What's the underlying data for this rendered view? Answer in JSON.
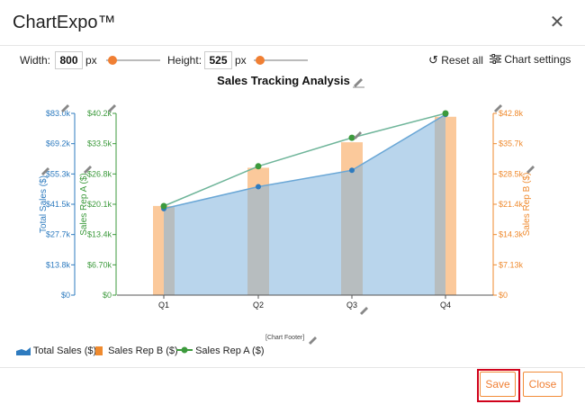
{
  "app": {
    "title": "ChartExpo™"
  },
  "toolbar": {
    "width_label": "Width:",
    "width_value": "800",
    "width_unit": "px",
    "height_label": "Height:",
    "height_value": "525",
    "height_unit": "px",
    "reset_label": "Reset all",
    "settings_label": "Chart settings",
    "width_slider": 0.12,
    "height_slider": 0.12
  },
  "chart_data": {
    "type": "bar",
    "title": "Sales Tracking Analysis",
    "categories": [
      "Q1",
      "Q2",
      "Q3",
      "Q4"
    ],
    "series": [
      {
        "name": "Total Sales ($)",
        "type": "area",
        "axis": "left-outer",
        "color": "#7fb3dc",
        "values": [
          39500,
          49500,
          57000,
          82500
        ]
      },
      {
        "name": "Sales Rep A ($)",
        "type": "line",
        "axis": "left-inner",
        "color": "#3c9a3c",
        "values": [
          19700,
          28500,
          34800,
          40200
        ]
      },
      {
        "name": "Sales Rep B ($)",
        "type": "bar",
        "axis": "right",
        "color": "#fbc99b",
        "values": [
          21000,
          30000,
          36000,
          42000
        ]
      }
    ],
    "axes": {
      "left_outer": {
        "label": "Total Sales ($)",
        "color": "#2e7bbf",
        "ticks": [
          "$0",
          "$13.8k",
          "$27.7k",
          "$41.5k",
          "$55.3k",
          "$69.2k",
          "$83.0k"
        ],
        "ylim": [
          0,
          83000
        ]
      },
      "left_inner": {
        "label": "Sales Rep A ($)",
        "color": "#3c9a3c",
        "ticks": [
          "$0",
          "$6.70k",
          "$13.4k",
          "$20.1k",
          "$26.8k",
          "$33.5k",
          "$40.2k"
        ],
        "ylim": [
          0,
          40200
        ]
      },
      "right": {
        "label": "Sales Rep B ($)",
        "color": "#ef8a2e",
        "ticks": [
          "$0",
          "$7.13k",
          "$14.3k",
          "$21.4k",
          "$28.5k",
          "$35.7k",
          "$42.8k"
        ],
        "ylim": [
          0,
          42800
        ]
      }
    },
    "footer": "[Chart Footer]"
  },
  "legend": {
    "items": [
      {
        "label": "Total Sales ($)",
        "icon": "area-chart-icon",
        "color": "#2e7bbf"
      },
      {
        "label": "Sales Rep B ($)",
        "icon": "bar-chart-icon",
        "color": "#ef8a2e"
      },
      {
        "label": "Sales Rep A ($)",
        "icon": "line-chart-icon",
        "color": "#3c9a3c"
      }
    ]
  },
  "buttons": {
    "save_label": "Save",
    "close_label": "Close"
  }
}
